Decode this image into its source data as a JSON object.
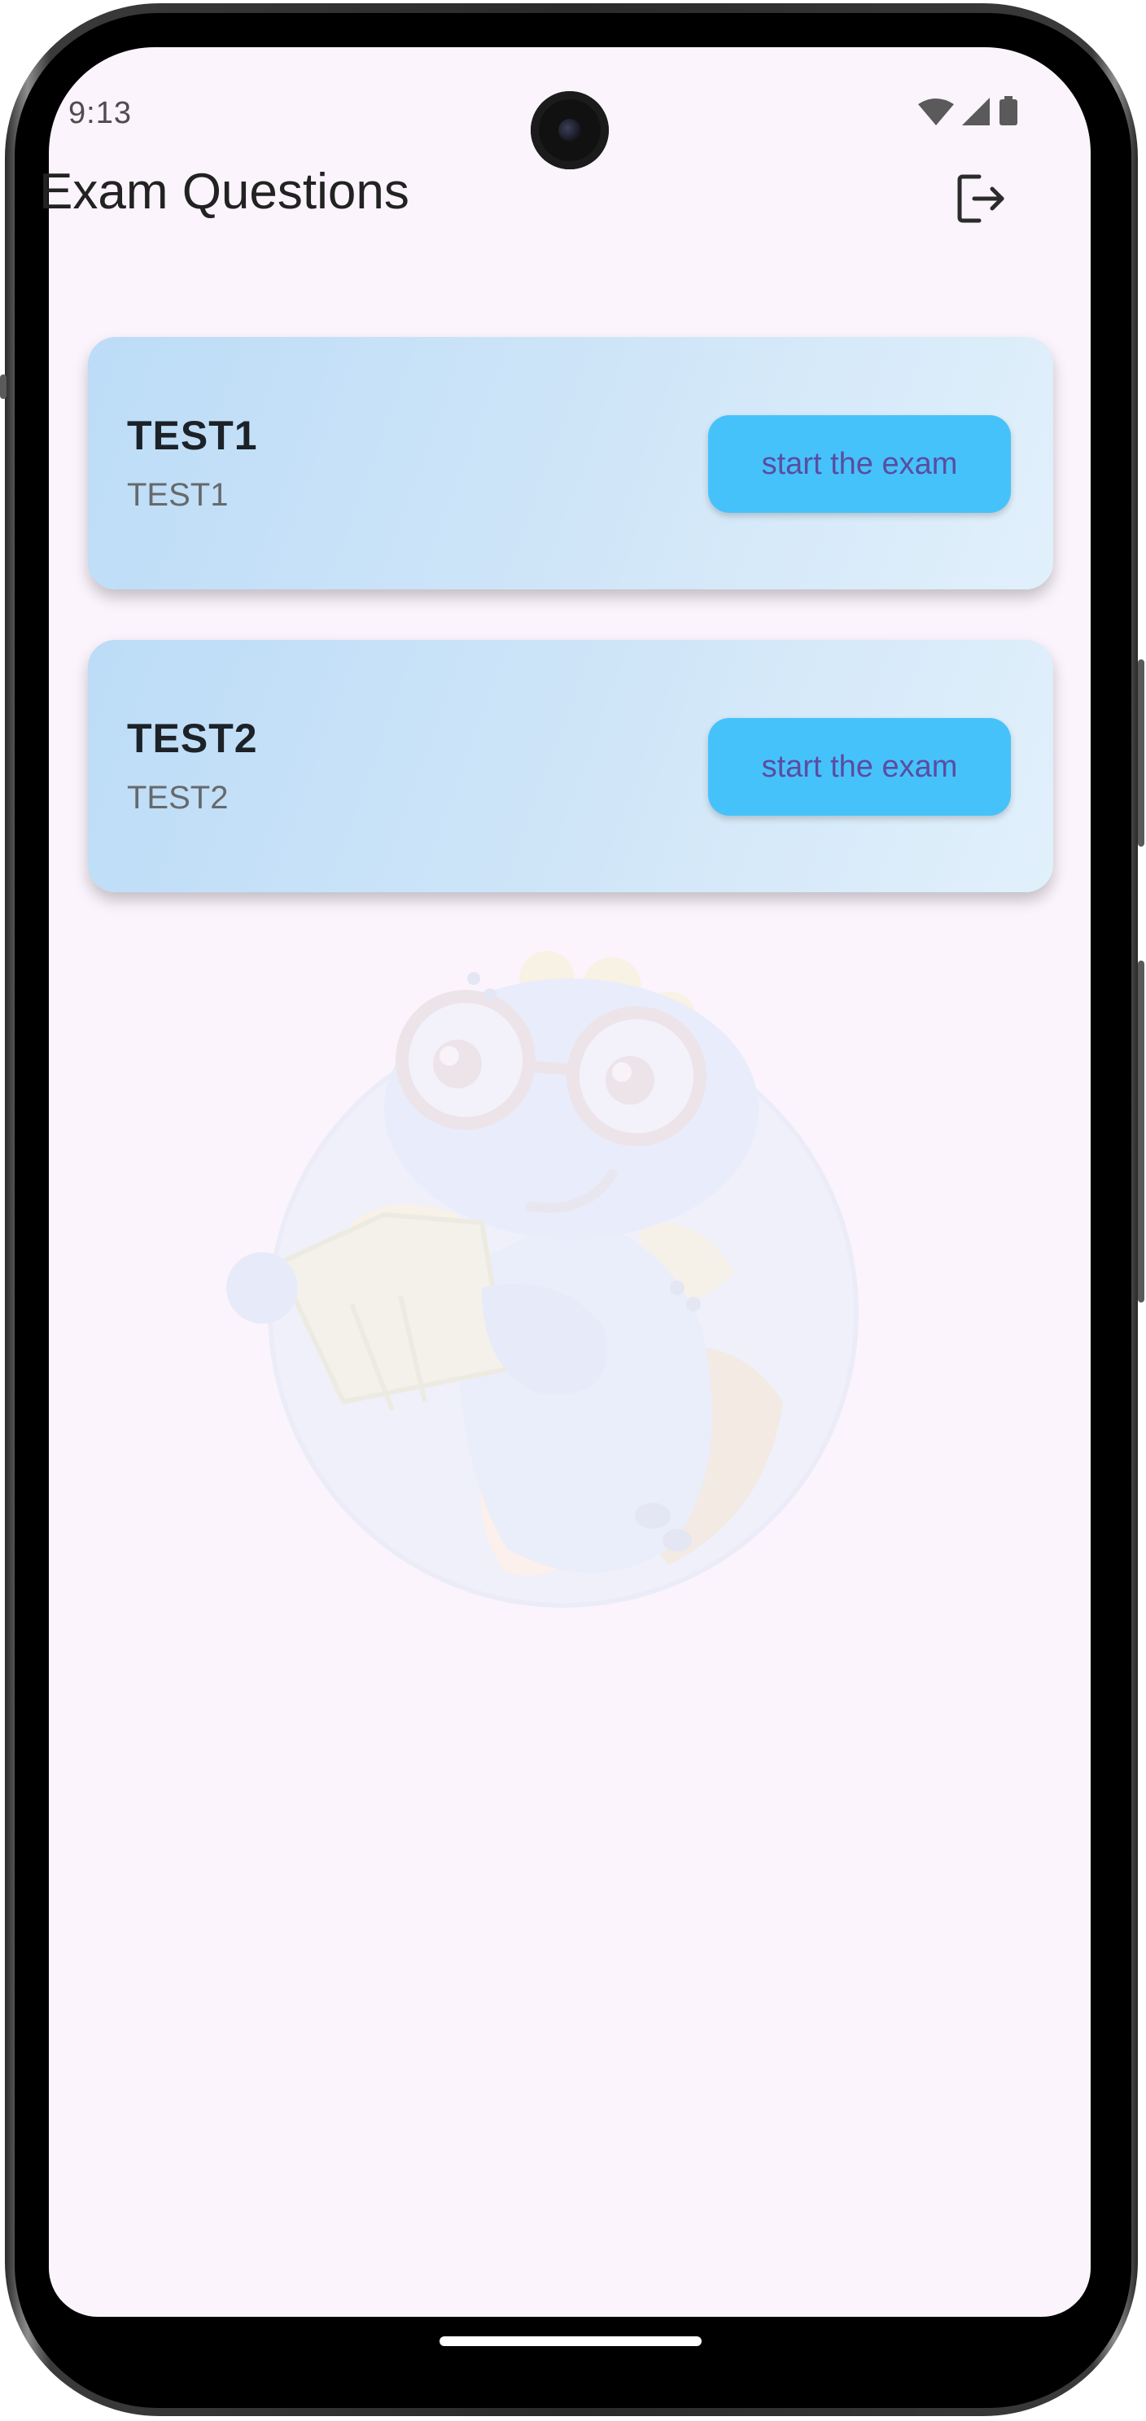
{
  "status_bar": {
    "time": "9:13"
  },
  "app_bar": {
    "title": "Exam Questions",
    "logout_icon": "logout-icon"
  },
  "exams": [
    {
      "title": "TEST1",
      "subtitle": "TEST1",
      "button_label": "start the exam"
    },
    {
      "title": "TEST2",
      "subtitle": "TEST2",
      "button_label": "start the exam"
    }
  ],
  "colors": {
    "background": "#fbf4fc",
    "card_gradient_start": "#bcdcf7",
    "card_gradient_end": "#e1f0fb",
    "button": "#46c2fb",
    "button_text": "#5a4da0"
  },
  "icons": {
    "wifi": "wifi-icon",
    "signal": "cellular-signal-icon",
    "battery": "battery-icon",
    "mascot": "dinosaur-reading-mascot-illustration"
  }
}
